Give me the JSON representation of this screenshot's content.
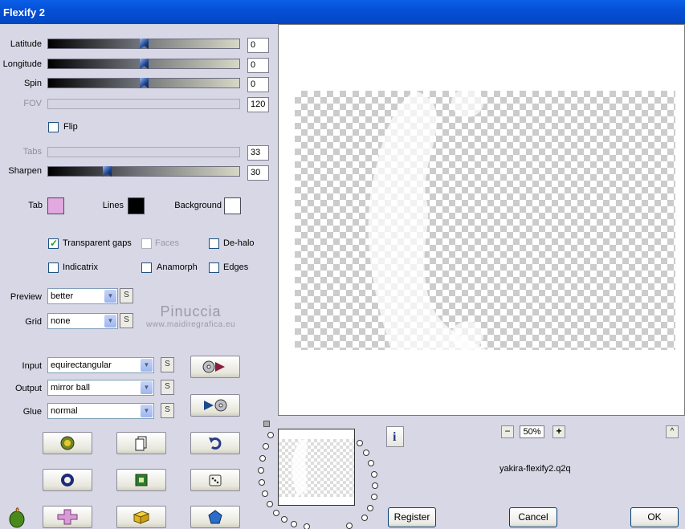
{
  "window": {
    "title": "Flexify 2"
  },
  "sliders": [
    {
      "id": "latitude",
      "label": "Latitude",
      "value": "0",
      "enabled": true,
      "pos": 0.5
    },
    {
      "id": "longitude",
      "label": "Longitude",
      "value": "0",
      "enabled": true,
      "pos": 0.5
    },
    {
      "id": "spin",
      "label": "Spin",
      "value": "0",
      "enabled": true,
      "pos": 0.5
    },
    {
      "id": "fov",
      "label": "FOV",
      "value": "120",
      "enabled": false
    },
    {
      "id": "tabs",
      "label": "Tabs",
      "value": "33",
      "enabled": false
    },
    {
      "id": "sharpen",
      "label": "Sharpen",
      "value": "30",
      "enabled": true,
      "pos": 0.3
    }
  ],
  "flip": {
    "label": "Flip",
    "checked": false
  },
  "colors": {
    "tab": {
      "label": "Tab",
      "color": "#e1a9e0"
    },
    "lines": {
      "label": "Lines",
      "color": "#000000"
    },
    "background": {
      "label": "Background",
      "color": "#ffffff"
    }
  },
  "options": {
    "transparent_gaps": {
      "label": "Transparent gaps",
      "checked": true
    },
    "faces": {
      "label": "Faces",
      "checked": false,
      "enabled": false
    },
    "de_halo": {
      "label": "De-halo",
      "checked": false
    },
    "indicatrix": {
      "label": "Indicatrix",
      "checked": false
    },
    "anamorph": {
      "label": "Anamorph",
      "checked": false
    },
    "edges": {
      "label": "Edges",
      "checked": false
    }
  },
  "preview_select": {
    "label": "Preview",
    "value": "better"
  },
  "grid_select": {
    "label": "Grid",
    "value": "none"
  },
  "input_select": {
    "label": "Input",
    "value": "equirectangular"
  },
  "output_select": {
    "label": "Output",
    "value": "mirror ball"
  },
  "glue_select": {
    "label": "Glue",
    "value": "normal"
  },
  "s_button": "S",
  "watermark": {
    "line1": "Pinuccia",
    "line2": "www.maidiregrafica.eu"
  },
  "zoom": {
    "minus": "−",
    "value": "50%",
    "plus": "+"
  },
  "up_button": "^",
  "info_button": "i",
  "filename": "yakira-flexify2.q2q",
  "buttons": {
    "register": "Register",
    "cancel": "Cancel",
    "ok": "OK"
  }
}
